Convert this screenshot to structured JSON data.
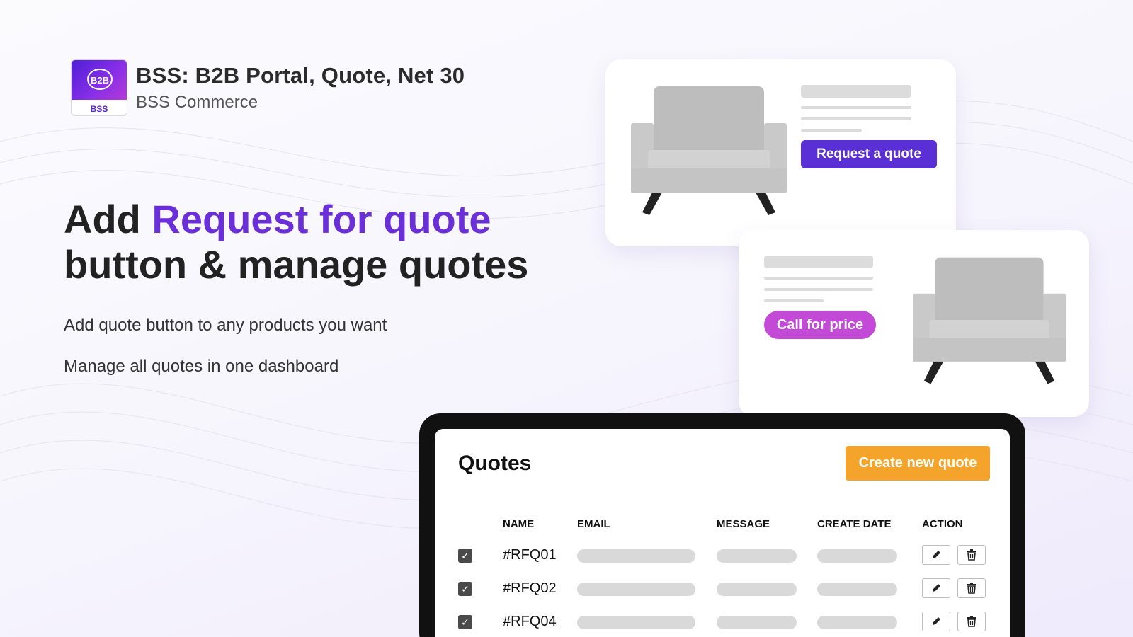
{
  "app": {
    "title": "BSS: B2B Portal, Quote, Net 30",
    "vendor": "BSS Commerce",
    "logo_text_top": "B2B",
    "logo_text_bottom": "BSS"
  },
  "hero": {
    "headline_prefix": "Add ",
    "headline_accent": "Request for quote",
    "headline_line2": "button & manage quotes",
    "sub1": "Add quote button to any products you want",
    "sub2": "Manage all quotes in one dashboard"
  },
  "cards": {
    "request_button": "Request a quote",
    "call_button": "Call for price"
  },
  "dashboard": {
    "title": "Quotes",
    "create_button": "Create new quote",
    "columns": [
      "NAME",
      "EMAIL",
      "MESSAGE",
      "CREATE DATE",
      "ACTION"
    ],
    "rows": [
      {
        "id": "#RFQ01",
        "checked": true
      },
      {
        "id": "#RFQ02",
        "checked": true
      },
      {
        "id": "#RFQ04",
        "checked": true
      }
    ]
  },
  "icons": {
    "edit": "pencil-icon",
    "delete": "trash-icon",
    "check": "check-icon"
  },
  "colors": {
    "accent_purple": "#6a2fd8",
    "request_button": "#5b2fd6",
    "call_button": "#c24ad7",
    "create_button": "#f4a42a"
  }
}
